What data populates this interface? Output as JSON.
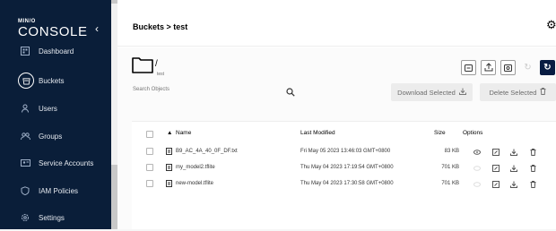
{
  "sidebar": {
    "logo_min": "MIN/O",
    "logo_console": "CONSOLE",
    "items": [
      {
        "label": "Dashboard",
        "icon": "dashboard-icon"
      },
      {
        "label": "Buckets",
        "icon": "bucket-icon"
      },
      {
        "label": "Users",
        "icon": "user-icon"
      },
      {
        "label": "Groups",
        "icon": "groups-icon"
      },
      {
        "label": "Service Accounts",
        "icon": "service-account-icon"
      },
      {
        "label": "IAM Policies",
        "icon": "shield-icon"
      },
      {
        "label": "Settings",
        "icon": "gear-icon"
      }
    ]
  },
  "header": {
    "breadcrumb": "Buckets > test"
  },
  "bucket": {
    "name": "/",
    "path": "test"
  },
  "search": {
    "placeholder": "Search Objects"
  },
  "actions": {
    "download_selected": "Download Selected",
    "delete_selected": "Delete Selected"
  },
  "table": {
    "columns": {
      "name": "Name",
      "last_modified": "Last Modified",
      "size": "Size",
      "options": "Options"
    },
    "rows": [
      {
        "name": "B9_AC_4A_40_0F_DF.txt",
        "last_modified": "Fri May 05 2023 13:46:03 GMT+0800",
        "size": "83 KB"
      },
      {
        "name": "my_model2.tflite",
        "last_modified": "Thu May 04 2023 17:19:54 GMT+0800",
        "size": "701 KB"
      },
      {
        "name": "new-model.tflite",
        "last_modified": "Thu May 04 2023 17:30:58 GMT+0800",
        "size": "701 KB"
      }
    ]
  },
  "colors": {
    "sidebar": "#0a1e39",
    "accent": "#081c42"
  }
}
